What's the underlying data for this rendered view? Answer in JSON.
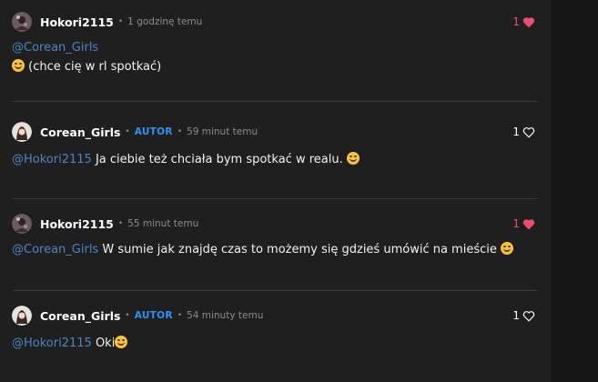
{
  "comments": [
    {
      "user": "Hokori2115",
      "badge": "",
      "time": "1 godzinę temu",
      "likes": "1",
      "liked": true,
      "mention": "@Corean_Girls",
      "text": "(chce cię w rl spotkać)",
      "emoji": "smiling-hearts-emoji"
    },
    {
      "user": "Corean_Girls",
      "badge": "AUTOR",
      "time": "59 minut temu",
      "likes": "1",
      "liked": false,
      "mention": "@Hokori2115",
      "text": "Ja ciebie też chciała bym spotkać w realu.",
      "emoji": "hugging-face-emoji"
    },
    {
      "user": "Hokori2115",
      "badge": "",
      "time": "55 minut temu",
      "likes": "1",
      "liked": true,
      "mention": "@Corean_Girls",
      "text": "W sumie jak znajdę czas to możemy się gdzieś umówić na mieście",
      "emoji": "smiling-face-emoji"
    },
    {
      "user": "Corean_Girls",
      "badge": "AUTOR",
      "time": "54 minuty temu",
      "likes": "1",
      "liked": false,
      "mention": "@Hokori2115",
      "text": "Oki",
      "emoji": "hugging-face-emoji"
    }
  ],
  "colors": {
    "background": "#1f1f1f",
    "mention": "#4a86c2",
    "badge": "#2d95f3",
    "heart": "#e94e6f"
  }
}
